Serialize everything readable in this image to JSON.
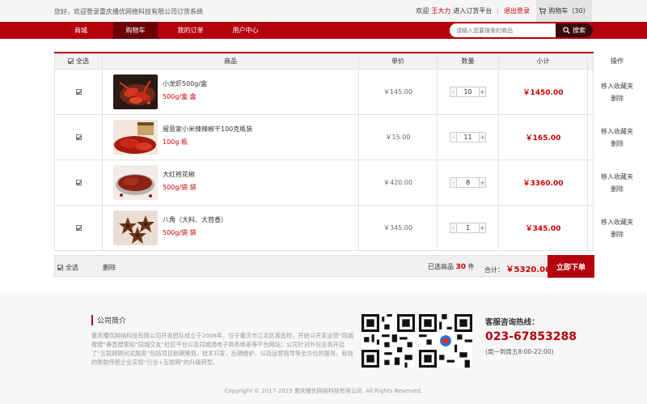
{
  "topbar": {
    "welcome": "您好，欢迎登录重庆播优网络科技有限公司订货系统",
    "greeting": "欢迎",
    "user_name": "王大力",
    "enter_platform": "进入订货平台",
    "separator": "|",
    "logout": "退出登录",
    "cart_label": "购物车（30）"
  },
  "nav": {
    "items": [
      "商城",
      "购物车",
      "我的订单",
      "用户中心"
    ],
    "active": "购物车"
  },
  "search": {
    "placeholder": "请输入您要搜索的商品",
    "button": "搜索"
  },
  "table": {
    "headers": [
      "全选",
      "商品",
      "单价",
      "数量",
      "小计",
      "操作"
    ],
    "rows": [
      {
        "name": "小龙虾500g/盒",
        "spec": "500g/盒 盒",
        "price": "￥145.00",
        "qty": "10",
        "subtotal": "￥1450.00",
        "op1": "移入收藏夹",
        "op2": "删除",
        "checked": true
      },
      {
        "name": "留意家小米辣辣椒干100克瓶装",
        "spec": "100g 瓶",
        "price": "￥15.00",
        "qty": "11",
        "subtotal": "￥165.00",
        "op1": "移入收藏夹",
        "op2": "删除",
        "checked": true
      },
      {
        "name": "大红袍花椒",
        "spec": "500g/袋 袋",
        "price": "￥420.00",
        "qty": "8",
        "subtotal": "￥3360.00",
        "op1": "移入收藏夹",
        "op2": "删除",
        "checked": true
      },
      {
        "name": "八角（大料、大茴香）",
        "spec": "500g/袋 袋",
        "price": "￥345.00",
        "qty": "1",
        "subtotal": "￥345.00",
        "op1": "移入收藏夹",
        "op2": "删除",
        "checked": true
      }
    ],
    "minus": "-",
    "plus": "+"
  },
  "summary": {
    "select_all": "全选",
    "delete": "删除",
    "selected_prefix": "已选商品",
    "selected_count": "30",
    "selected_suffix": "件",
    "total_label": "合计：",
    "total_value": "￥5320.00",
    "order_button": "立即下单"
  },
  "footer": {
    "about_title": "公司简介",
    "about_text": "重庆播优网络科技有限公司开发团队成立于2008年，位于重庆市江北区观音桥，开始以开发运营“同城搜搜”垂直搜索和“同城交友”社区平台以及同城通电子商务体系等平台网站；公司针对外包业务开启了“互联网顾问式服务”包括项目前期策划，技术开发，后期维护，以及运营指导等全方位的服务，有效的帮助传统企业实现“行业+互联网”的升级转型。",
    "service_title": "客服咨询热线：",
    "phone": "023-67853288",
    "hours": "(周一到周五8:00-22:00)",
    "copyright": "Copyright © 2017-2023 重庆播优网络科技有限公司. All Rights Reserved."
  },
  "colors": {
    "brand_red": "#b5000d",
    "nav_active": "#6b0007",
    "price_red": "#cc0000"
  }
}
